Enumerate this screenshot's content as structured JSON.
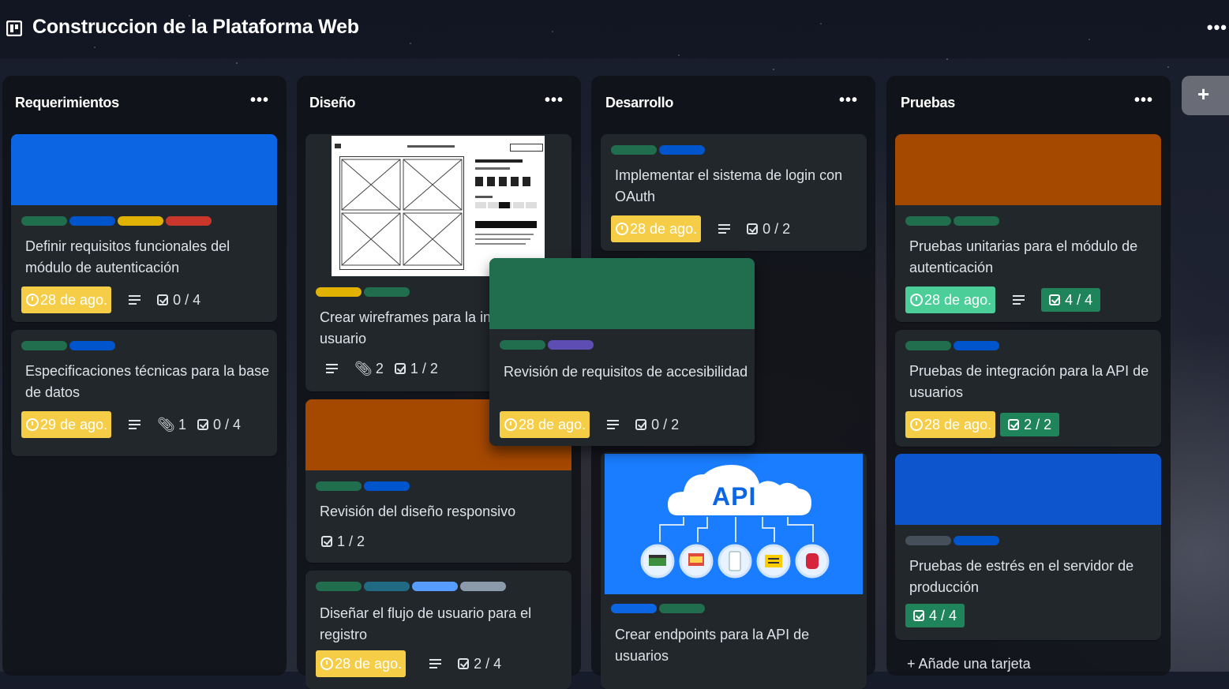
{
  "board": {
    "title": "Construccion de la Plataforma Web",
    "menu": "•••"
  },
  "colors": {
    "green": "#216e4e",
    "blue": "#0c66e4",
    "yellow": "#e2b203",
    "red": "#c9372c",
    "purple": "#5e4db2",
    "teal": "#206a83",
    "sky": "#579dff",
    "gray": "#8c9bab",
    "orange": "#a54800",
    "due_yellow": "#f5cd47",
    "done_green": "#1f845a"
  },
  "lists": [
    {
      "title": "Requerimientos",
      "cards": [
        {
          "title": "Definir requisitos funcionales del módulo de autenticación",
          "due": "28 de ago.",
          "checklist": "0 / 4",
          "labels": [
            "green",
            "blue",
            "yellow",
            "red"
          ],
          "cover": "blue"
        },
        {
          "title": "Especificaciones técnicas para la base de datos",
          "due": "29 de ago.",
          "attachments": "1",
          "checklist": "0 / 4",
          "labels": [
            "green",
            "blue"
          ]
        }
      ]
    },
    {
      "title": "Diseño",
      "cards": [
        {
          "title": "Crear wireframes para la interfaz de usuario",
          "attachments": "2",
          "checklist": "1 / 2",
          "labels": [
            "yellow",
            "green"
          ],
          "cover": "wireframe-image"
        },
        {
          "title": "Revisión del diseño responsivo",
          "checklist": "1 / 2",
          "labels": [
            "green",
            "blue"
          ],
          "cover": "orange"
        },
        {
          "title": "Diseñar el flujo de usuario para el registro",
          "due": "28 de ago.",
          "checklist": "2 / 4",
          "labels": [
            "green",
            "teal",
            "sky",
            "gray"
          ]
        }
      ]
    },
    {
      "title": "Desarrollo",
      "cards": [
        {
          "title": "Implementar el sistema de login con OAuth",
          "due": "28 de ago.",
          "checklist": "0 / 2",
          "labels": [
            "green",
            "blue"
          ]
        },
        {
          "title": "Crear endpoints para la API de usuarios",
          "labels": [
            "blue",
            "green"
          ],
          "cover": "api-image",
          "cover_text": "API"
        }
      ]
    },
    {
      "title": "Pruebas",
      "cards": [
        {
          "title": "Pruebas unitarias para el módulo de autenticación",
          "due": "28 de ago.",
          "checklist": "4 / 4",
          "labels": [
            "green",
            "green"
          ],
          "cover": "orange"
        },
        {
          "title": "Pruebas de integración para la API de usuarios",
          "due": "28 de ago.",
          "checklist": "2 / 2",
          "labels": [
            "green",
            "blue"
          ]
        },
        {
          "title": "Pruebas de estrés en el servidor de producción",
          "checklist": "4 / 4",
          "labels": [
            "gray",
            "blue"
          ],
          "cover": "blue"
        }
      ],
      "add_card": "+ Añade una tarjeta"
    }
  ],
  "dragging_card": {
    "title": "Revisión de requisitos de accesibilidad",
    "due": "28 de ago.",
    "checklist": "0 / 2",
    "labels": [
      "green",
      "purple"
    ],
    "cover": "green"
  },
  "add_list": "+"
}
